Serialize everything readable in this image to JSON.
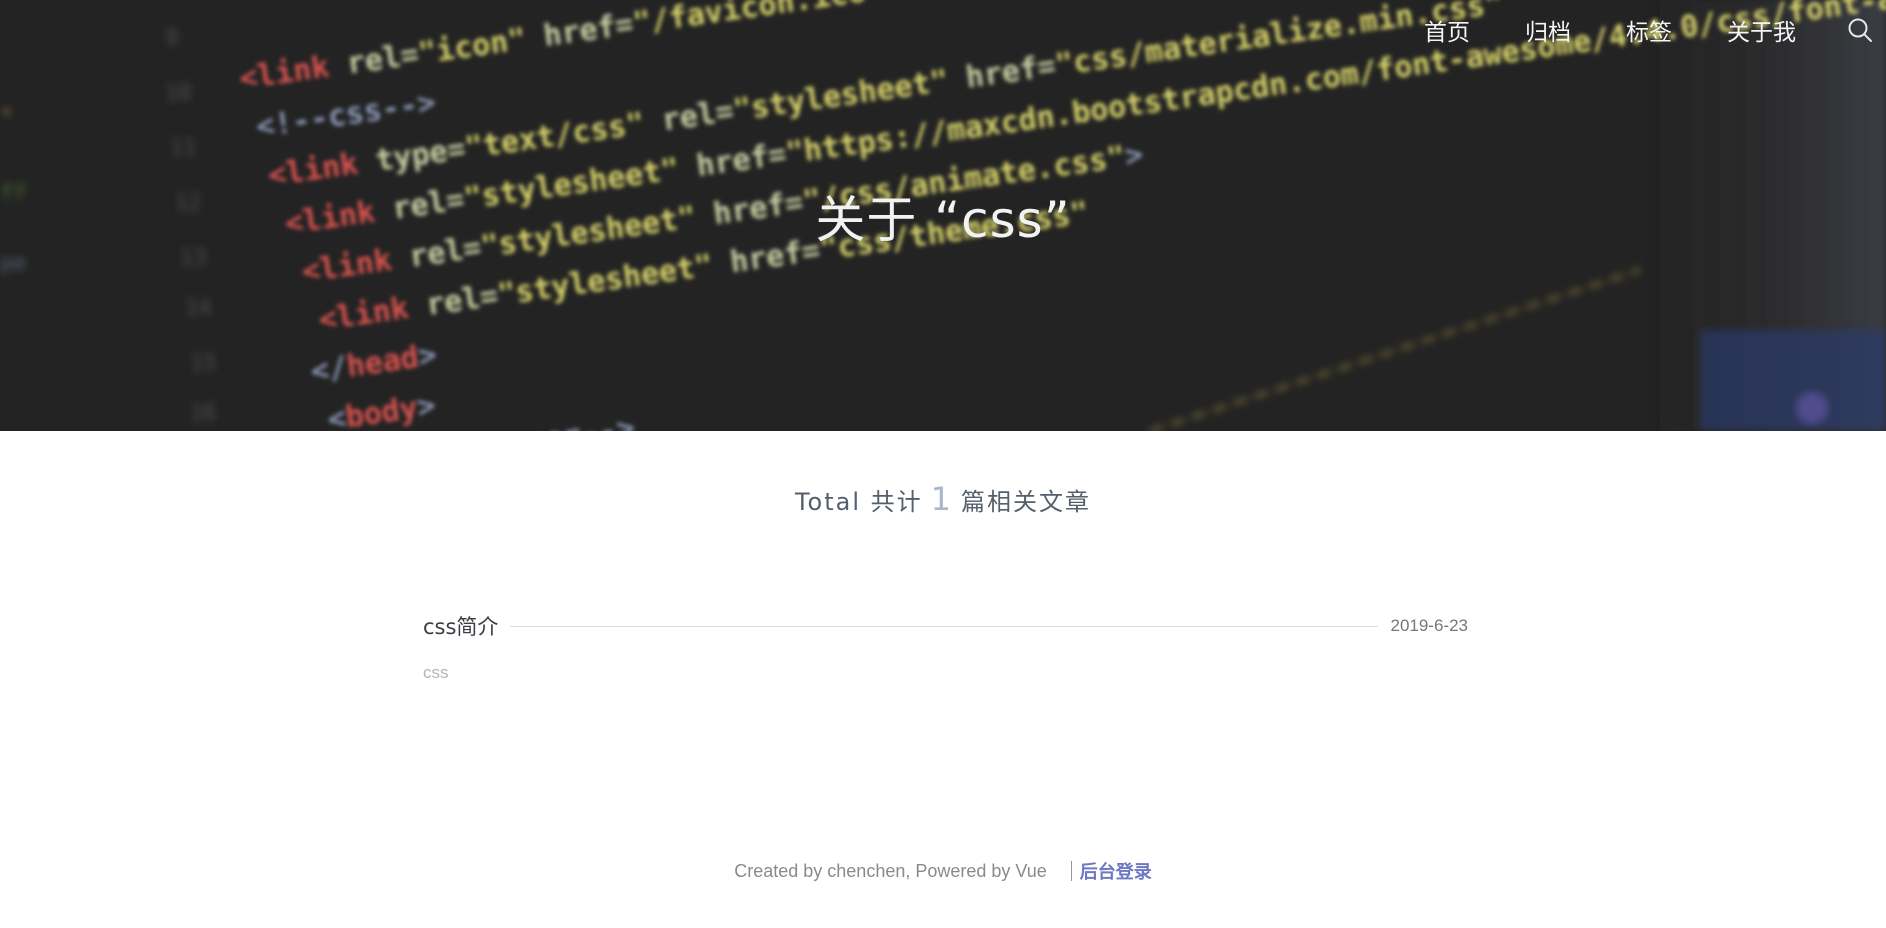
{
  "nav": {
    "items": [
      {
        "label": "首页"
      },
      {
        "label": "归档"
      },
      {
        "label": "标签"
      },
      {
        "label": "关于我"
      }
    ],
    "search_icon": "search-icon"
  },
  "banner": {
    "title": "关于 “css”"
  },
  "summary": {
    "prefix": "Total 共计",
    "count": "1",
    "suffix": "篇相关文章"
  },
  "posts": [
    {
      "title": "css简介",
      "date": "2019-6-23",
      "tag": "css"
    }
  ],
  "footer": {
    "text": "Created by chenchen, Powered by Vue",
    "login": "后台登录"
  },
  "colors": {
    "banner_bg": "#232323",
    "accent": "#6b78c4",
    "count": "#a9b9cc"
  }
}
